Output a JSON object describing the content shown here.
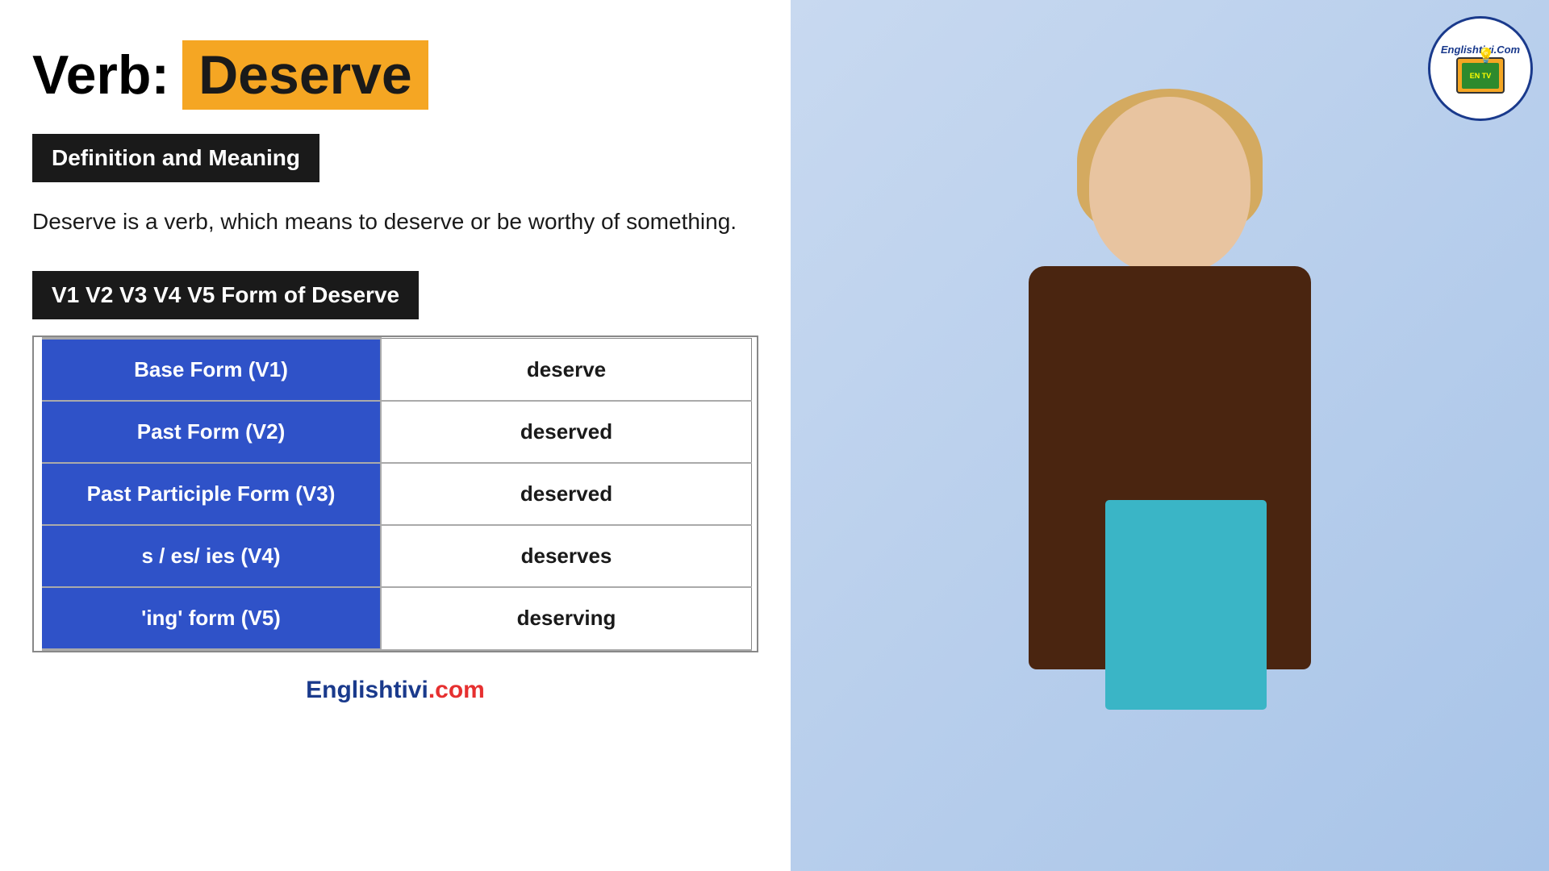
{
  "header": {
    "verb_label": "Verb:",
    "verb_word": "Deserve"
  },
  "definition": {
    "badge_label": "Definition and Meaning",
    "text": "Deserve is a verb, which means to deserve or be worthy of something."
  },
  "forms_section": {
    "badge_label": "V1 V2 V3 V4 V5 Form of Deserve",
    "table_rows": [
      {
        "label": "Base Form (V1)",
        "value": "deserve"
      },
      {
        "label": "Past Form (V2)",
        "value": "deserved"
      },
      {
        "label": "Past Participle Form (V3)",
        "value": "deserved"
      },
      {
        "label": "s / es/ ies (V4)",
        "value": "deserves"
      },
      {
        "label": "'ing' form (V5)",
        "value": "deserving"
      }
    ]
  },
  "footer": {
    "brand_dark": "Englishtivi",
    "brand_red": ".com"
  },
  "logo": {
    "text": "Englishtivi.Com",
    "tv_text": "EN TV"
  },
  "colors": {
    "amber": "#f5a623",
    "dark": "#1a1a1a",
    "blue": "#2f52c8",
    "navy": "#1a3a8c",
    "red": "#e63030",
    "white": "#ffffff",
    "light_blue_bg": "#c5d8f5"
  }
}
